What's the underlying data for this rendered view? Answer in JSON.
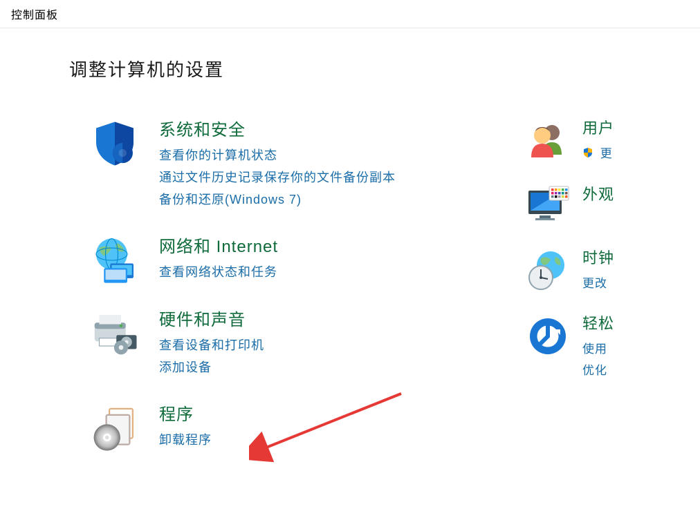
{
  "titlebar": {
    "label": "控制面板"
  },
  "heading": "调整计算机的设置",
  "left": {
    "security": {
      "title": "系统和安全",
      "links": [
        "查看你的计算机状态",
        "通过文件历史记录保存你的文件备份副本",
        "备份和还原(Windows 7)"
      ]
    },
    "network": {
      "title": "网络和 Internet",
      "links": [
        "查看网络状态和任务"
      ]
    },
    "hardware": {
      "title": "硬件和声音",
      "links": [
        "查看设备和打印机",
        "添加设备"
      ]
    },
    "programs": {
      "title": "程序",
      "links": [
        "卸载程序"
      ]
    }
  },
  "right": {
    "users": {
      "title": "用户",
      "links": [
        "更"
      ]
    },
    "appearance": {
      "title": "外观"
    },
    "time": {
      "title": "时钟",
      "links": [
        "更改"
      ]
    },
    "ease": {
      "title": "轻松",
      "links": [
        "使用",
        "优化"
      ]
    }
  }
}
